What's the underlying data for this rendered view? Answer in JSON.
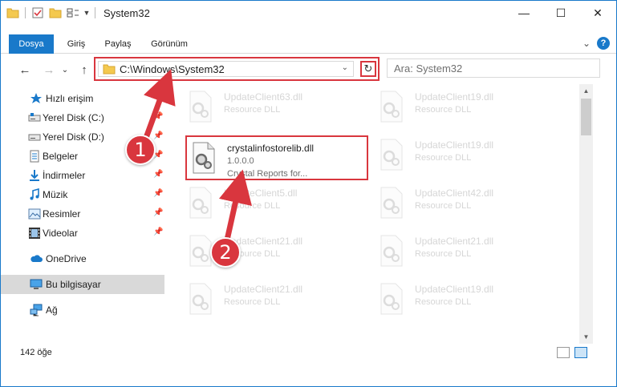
{
  "window": {
    "title": "System32",
    "controls": {
      "minimize": "—",
      "maximize": "☐",
      "close": "✕"
    }
  },
  "ribbon": {
    "tabs": [
      "Dosya",
      "Giriş",
      "Paylaş",
      "Görünüm"
    ],
    "active_tab": "Dosya",
    "collapse_glyph": "⌄",
    "help_glyph": "?"
  },
  "navigation": {
    "back": "←",
    "forward": "→",
    "recent": "⌄",
    "up": "↑"
  },
  "address": {
    "path": "C:\\Windows\\System32",
    "dropdown_glyph": "⌄",
    "refresh_glyph": "↻"
  },
  "search": {
    "placeholder": "Ara: System32"
  },
  "sidebar": {
    "quick_access": "Hızlı erişim",
    "items": [
      {
        "label": "Yerel Disk (C:)",
        "pinned": true
      },
      {
        "label": "Yerel Disk (D:)",
        "pinned": true
      },
      {
        "label": "Belgeler",
        "pinned": true
      },
      {
        "label": "İndirmeler",
        "pinned": true
      },
      {
        "label": "Müzik",
        "pinned": true
      },
      {
        "label": "Resimler",
        "pinned": true
      },
      {
        "label": "Videolar",
        "pinned": true
      }
    ],
    "onedrive": "OneDrive",
    "this_pc": "Bu bilgisayar",
    "network": "Ağ",
    "pin_glyph": "📌"
  },
  "files": {
    "left_column": [
      {
        "name": "UpdateClient63.dll",
        "type": "Resource DLL"
      },
      {
        "name": "UpdateClient5.dll",
        "type": "Resource DLL"
      },
      {
        "name": "UpdateClient21.dll",
        "type": "Resource DLL"
      },
      {
        "name": "UpdateClient21.dll",
        "type": "Resource DLL"
      }
    ],
    "right_column": [
      {
        "name": "UpdateClient19.dll",
        "type": "Resource DLL"
      },
      {
        "name": "UpdateClient19.dll",
        "type": "Resource DLL"
      },
      {
        "name": "UpdateClient42.dll",
        "type": "Resource DLL"
      },
      {
        "name": "UpdateClient21.dll",
        "type": "Resource DLL"
      },
      {
        "name": "UpdateClient19.dll",
        "type": "Resource DLL"
      }
    ],
    "highlighted": {
      "name": "crystalinfostorelib.dll",
      "version": "1.0.0.0",
      "description": "Crystal Reports for..."
    }
  },
  "status": {
    "item_count": "142 öğe"
  },
  "annotations": {
    "step1": "1",
    "step2": "2"
  },
  "colors": {
    "accent": "#1979ca",
    "highlight_red": "#d9363e"
  }
}
